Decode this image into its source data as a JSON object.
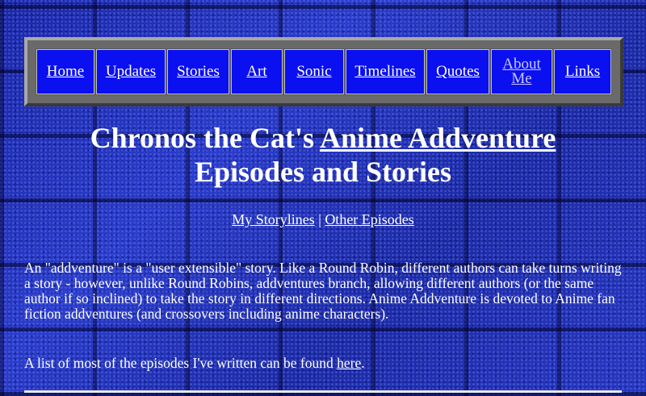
{
  "nav": {
    "items": [
      {
        "label": "Home"
      },
      {
        "label": "Updates"
      },
      {
        "label": "Stories"
      },
      {
        "label": "Art"
      },
      {
        "label": "Sonic"
      },
      {
        "label": "Timelines"
      },
      {
        "label": "Quotes"
      },
      {
        "label": "About Me"
      },
      {
        "label": "Links"
      }
    ]
  },
  "header": {
    "title_prefix": "Chronos the Cat's ",
    "title_link": "Anime Addventure",
    "title_line2": "Episodes and Stories"
  },
  "sublinks": {
    "my_storylines": "My Storylines",
    "separator": " | ",
    "other_episodes": "Other Episodes"
  },
  "content": {
    "intro": "An \"addventure\" is a \"user extensible\" story. Like a Round Robin, different authors can take turns writing a story - however, unlike Round Robins, addventures branch, allowing different authors (or the same author if so inclined) to take the story in different directions. Anime Addventure is devoted to Anime fan fiction addventures (and crossovers including anime characters).",
    "list_prefix": "A list of most of the episodes I've written can be found ",
    "list_link": "here",
    "list_suffix": "."
  },
  "colors": {
    "background": "#1f2fb8",
    "nav_cell": "#0a10f0",
    "frame": "#6a6a6a",
    "text": "#ffffff"
  }
}
